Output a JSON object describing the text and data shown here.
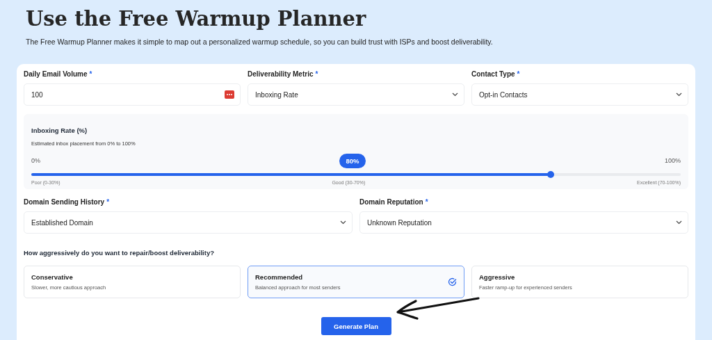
{
  "header": {
    "title": "Use the Free Warmup Planner",
    "subtitle": "The Free Warmup Planner makes it simple to map out a personalized warmup schedule, so you can build trust with ISPs and boost deliverability."
  },
  "top_fields": [
    {
      "label": "Daily Email Volume",
      "mark": "*",
      "kind": "number",
      "value": "100"
    },
    {
      "label": "Deliverability Metric",
      "mark": "*",
      "kind": "select",
      "value": "Inboxing Rate"
    },
    {
      "label": "Contact Type",
      "mark": "*",
      "kind": "select",
      "value": "Opt-in Contacts"
    }
  ],
  "slider": {
    "title": "Inboxing Rate (%)",
    "hint": "Estimated inbox placement from 0% to 100%",
    "min_label": "0%",
    "max_label": "100%",
    "reading": "80%",
    "level": 0.8,
    "bands": [
      "Poor (0-30%)",
      "Good (30-70%)",
      "Excellent (70-100%)"
    ]
  },
  "domain_fields": [
    {
      "label": "Domain Sending History",
      "mark": "*",
      "kind": "select",
      "value": "Established Domain"
    },
    {
      "label": "Domain Reputation",
      "mark": "*",
      "kind": "select",
      "value": "Unknown Reputation"
    }
  ],
  "question": "How aggressively do you want to repair/boost deliverability?",
  "options": [
    {
      "title": "Conservative",
      "description": "Slower, more cautious approach",
      "selected": false
    },
    {
      "title": "Recommended",
      "description": "Balanced approach for most senders",
      "selected": true
    },
    {
      "title": "Aggressive",
      "description": "Faster ramp-up for experienced senders",
      "selected": false
    }
  ],
  "button": "Generate Plan"
}
